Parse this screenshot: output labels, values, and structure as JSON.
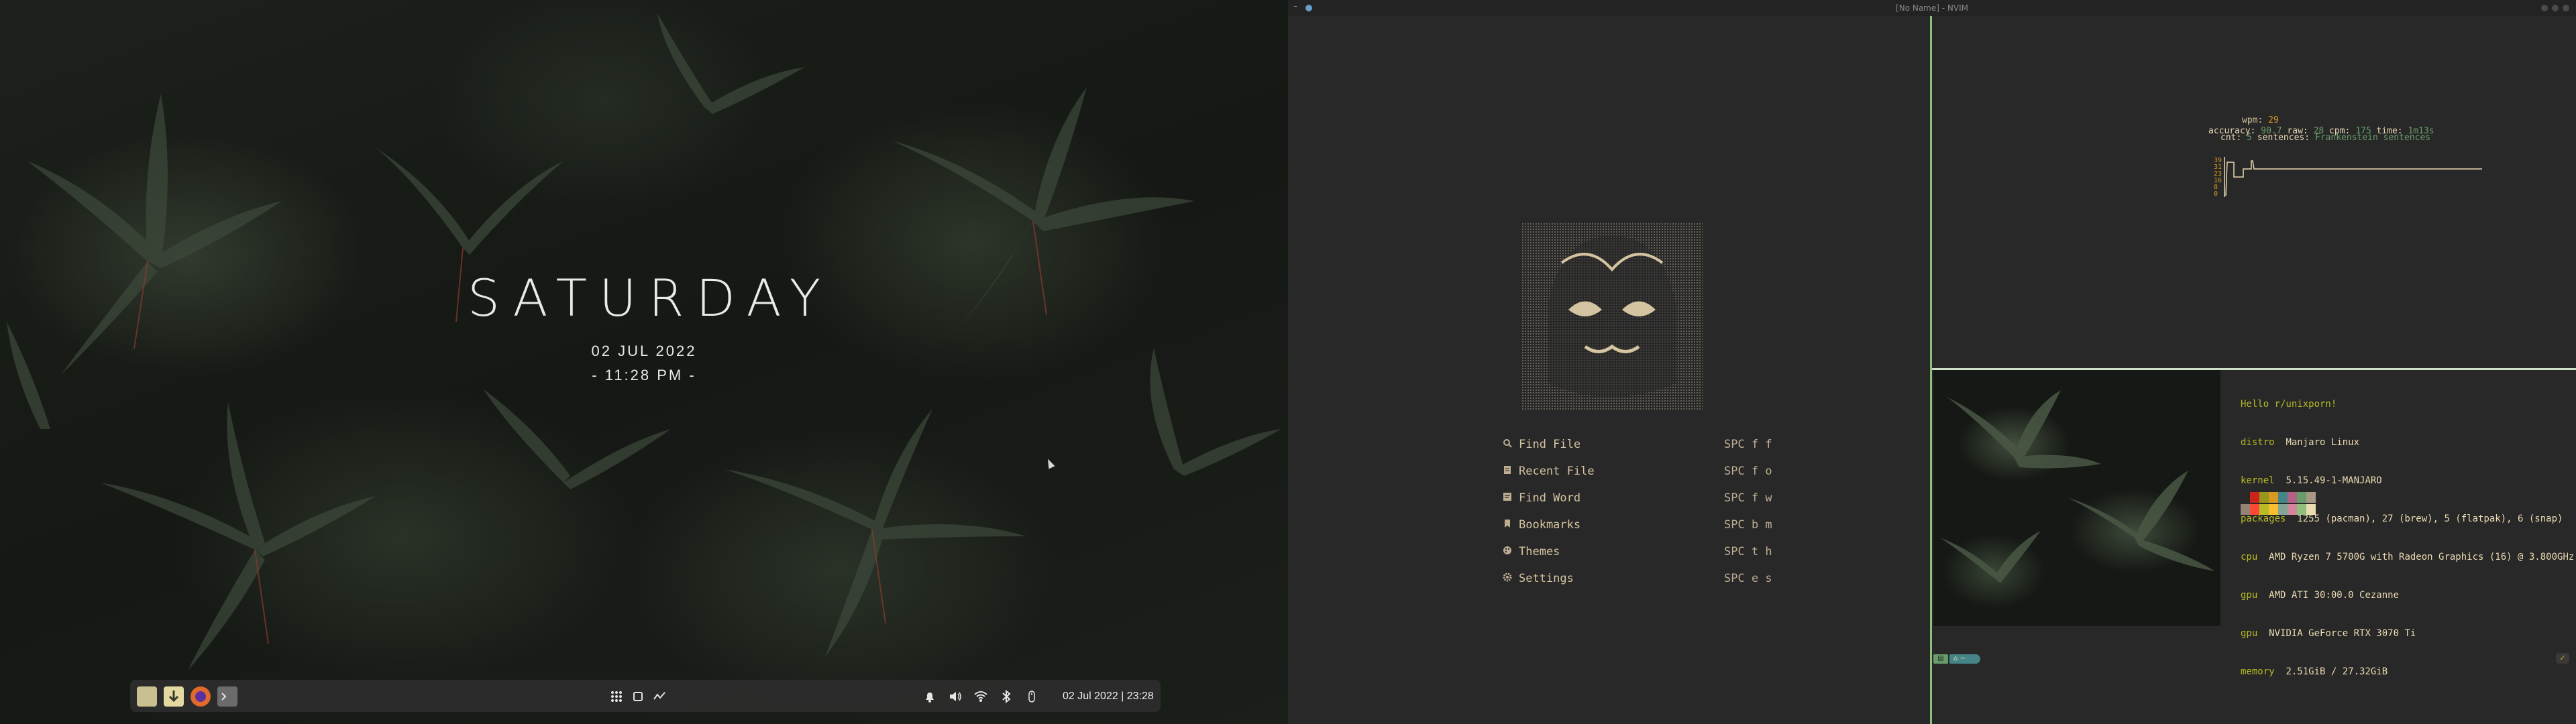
{
  "left_monitor": {
    "clock_widget": {
      "day": "SATURDAY",
      "date": "02 JUL 2022",
      "time": "- 11:28 PM -"
    },
    "dock": {
      "apps": [
        {
          "name": "file-manager-icon",
          "color": "#c9c08f"
        },
        {
          "name": "downloader-icon",
          "color": "#e4d9a0"
        },
        {
          "name": "firefox-icon",
          "color": "#e0692b"
        },
        {
          "name": "terminal-icon",
          "color": "#6b6b6b"
        }
      ],
      "center_icons": [
        "app-grid-icon",
        "workspace-icon",
        "activity-icon"
      ],
      "tray_icons": [
        "bell-icon",
        "volume-icon",
        "wifi-icon",
        "bluetooth-icon",
        "mouse-icon"
      ],
      "datetime": "02 Jul 2022 | 23:28"
    }
  },
  "right_monitor": {
    "window_title": "[No Name] - NVIM",
    "dashboard": {
      "menu": [
        {
          "icon": "search-icon",
          "label": "Find File",
          "key": "SPC f f"
        },
        {
          "icon": "recent-file-icon",
          "label": "Recent File",
          "key": "SPC f o"
        },
        {
          "icon": "find-word-icon",
          "label": "Find Word",
          "key": "SPC f w"
        },
        {
          "icon": "bookmark-icon",
          "label": "Bookmarks",
          "key": "SPC b m"
        },
        {
          "icon": "palette-icon",
          "label": "Themes",
          "key": "SPC t h"
        },
        {
          "icon": "gear-icon",
          "label": "Settings",
          "key": "SPC e s"
        }
      ]
    },
    "typing_test": {
      "wpm_label": "wpm:",
      "wpm_value": "29",
      "y_ticks": [
        "39",
        "31",
        "23",
        "16",
        "8",
        "0"
      ],
      "stats": {
        "accuracy_label": "accuracy:",
        "accuracy": "90.7",
        "raw_label": "raw:",
        "raw": "28",
        "cpm_label": "cpm:",
        "cpm": "175",
        "time_label": "time:",
        "time": "1m13s",
        "cnt_label": "cnt:",
        "cnt": "5",
        "sentences_label": "sentences:",
        "sentences": "Frankenstein sentences"
      }
    },
    "fetch": {
      "hello": "Hello r/unixporn!",
      "rows": [
        {
          "key": "distro",
          "value": "Manjaro Linux"
        },
        {
          "key": "kernel",
          "value": "5.15.49-1-MANJARO"
        },
        {
          "key": "packages",
          "value": "1255 (pacman), 27 (brew), 5 (flatpak), 6 (snap)"
        },
        {
          "key": "cpu",
          "value": "AMD Ryzen 7 5700G with Radeon Graphics (16) @ 3.800GHz"
        },
        {
          "key": "gpu",
          "value": "AMD ATI 30:00.0 Cezanne"
        },
        {
          "key": "gpu",
          "value": "NVIDIA GeForce RTX 3070 Ti"
        },
        {
          "key": "memory",
          "value": "2.51GiB / 27.32GiB"
        }
      ],
      "palette_dark": [
        "#282828",
        "#cc241d",
        "#98971a",
        "#d79921",
        "#458588",
        "#b16286",
        "#689d6a",
        "#a89984"
      ],
      "palette_light": [
        "#928374",
        "#fb4934",
        "#b8bb26",
        "#fabd2f",
        "#83a598",
        "#d3869b",
        "#8ec07c",
        "#ebdbb2"
      ]
    },
    "statusline": {
      "segment": "⌂ ~"
    }
  },
  "colors": {
    "accent_green": "#8ec07c",
    "fg": "#ebdbb2",
    "yellow": "#d79921",
    "green": "#b8bb26"
  }
}
